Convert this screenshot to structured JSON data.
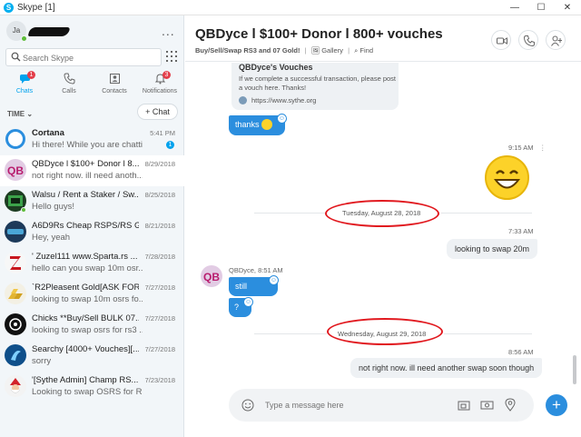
{
  "window": {
    "title": "Skype [1]",
    "minimize": "—",
    "maximize": "☐",
    "close": "✕"
  },
  "profile": {
    "initials": "Ja",
    "more": "..."
  },
  "search": {
    "placeholder": "Search Skype"
  },
  "nav": [
    {
      "label": "Chats",
      "badge": "1"
    },
    {
      "label": "Calls",
      "badge": ""
    },
    {
      "label": "Contacts",
      "badge": ""
    },
    {
      "label": "Notifications",
      "badge": "3"
    }
  ],
  "list_header": {
    "sort_label": "TIME",
    "new_chat": "+ Chat"
  },
  "conversations": [
    {
      "name": "Cortana",
      "preview": "Hi there! While you are chatti...",
      "date": "5:41 PM",
      "badge": "1"
    },
    {
      "name": "QBDyce l $100+ Donor l 8...",
      "preview": "not right now. ill need anoth...",
      "date": "8/29/2018",
      "badge": ""
    },
    {
      "name": "Walsu / Rent a Staker / Sw...",
      "preview": "Hello guys!",
      "date": "8/25/2018",
      "badge": ""
    },
    {
      "name": "A6D9Rs Cheap RSPS/RS G...",
      "preview": "Hey, yeah",
      "date": "8/21/2018",
      "badge": ""
    },
    {
      "name": "' Zuzel111  www.Sparta.rs ...",
      "preview": "hello can you swap 10m osr...",
      "date": "7/28/2018",
      "badge": ""
    },
    {
      "name": "`R2Pleasent Gold[ASK FOR...",
      "preview": "looking to swap 10m osrs fo...",
      "date": "7/27/2018",
      "badge": ""
    },
    {
      "name": "Chicks **Buy/Sell BULK 07...",
      "preview": "looking to swap osrs for rs3 ...",
      "date": "7/27/2018",
      "badge": ""
    },
    {
      "name": "Searchy  [4000+ Vouches][...",
      "preview": "sorry",
      "date": "7/27/2018",
      "badge": ""
    },
    {
      "name": "'[Sythe Admin] Champ RS...",
      "preview": "Looking to swap OSRS for R...",
      "date": "7/23/2018",
      "badge": ""
    }
  ],
  "chat": {
    "title": "QBDyce l $100+ Donor l 800+ vouches",
    "subtitle": "Buy/Sell/Swap RS3 and 07 Gold!",
    "sep": "|",
    "gallery": "Gallery",
    "find": "Find",
    "card_title": "QBDyce's Vouches",
    "card_desc": "If we complete a successful transaction, please post a vouch here. Thanks!",
    "card_link": "https://www.sythe.org",
    "msg_thanks": "thanks",
    "time_915": "9:15 AM",
    "date1": "Tuesday, August 28, 2018",
    "time_733": "7:33 AM",
    "msg_swap": "looking to swap 20m",
    "sender_stamp": "QBDyce, 8:51 AM",
    "msg_still": "still",
    "msg_q": "?",
    "date2": "Wednesday, August 29, 2018",
    "time_856": "8:56 AM",
    "msg_notnow": "not right now. ill need another swap soon though",
    "composer_placeholder": "Type a message here",
    "send_plus": "+"
  }
}
